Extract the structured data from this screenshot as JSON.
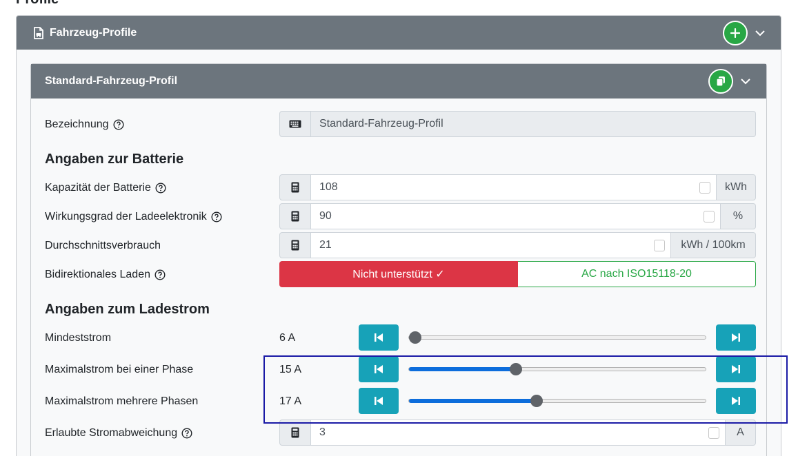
{
  "page": {
    "title": "Profile"
  },
  "vehicle_profiles": {
    "title": "Fahrzeug-Profile",
    "colors": {
      "header_bg": "#6c757d",
      "success": "#28a745",
      "danger": "#dc3545",
      "info": "#17a2b8",
      "slider_accent": "#0d6ddc"
    }
  },
  "profile": {
    "title": "Standard-Fahrzeug-Profil",
    "name_label": "Bezeichnung",
    "name_value": "Standard-Fahrzeug-Profil",
    "battery_section": "Angaben zur Batterie",
    "capacity_label": "Kapazität der Batterie",
    "capacity_value": "108",
    "capacity_unit": "kWh",
    "efficiency_label": "Wirkungsgrad der Ladeelektronik",
    "efficiency_value": "90",
    "efficiency_unit": "%",
    "consumption_label": "Durchschnittsverbrauch",
    "consumption_value": "21",
    "consumption_unit": "kWh / 100km",
    "bidi_label": "Bidirektionales Laden",
    "bidi_option_off": "Nicht unterstützt ✓",
    "bidi_option_ac": "AC nach ISO15118-20",
    "current_section": "Angaben zum Ladestrom",
    "min_current_label": "Mindeststrom",
    "min_current_value": "6 A",
    "min_current_level": 0.0,
    "max_single_label": "Maximalstrom bei einer Phase",
    "max_single_value": "15 A",
    "max_single_level": 0.36,
    "max_multi_label": "Maximalstrom mehrere Phasen",
    "max_multi_value": "17 A",
    "max_multi_level": 0.43,
    "deviation_label": "Erlaubte Stromabweichung",
    "deviation_value": "3",
    "deviation_unit": "A"
  },
  "icons": {
    "header": "file-car-icon",
    "add": "plus-icon",
    "copy": "copy-icon",
    "collapse": "chevron-down-icon",
    "keyboard": "keyboard-icon",
    "calculator": "calculator-icon",
    "help": "question-circle-icon",
    "step_back": "skip-backward-icon",
    "step_forward": "skip-forward-icon"
  }
}
